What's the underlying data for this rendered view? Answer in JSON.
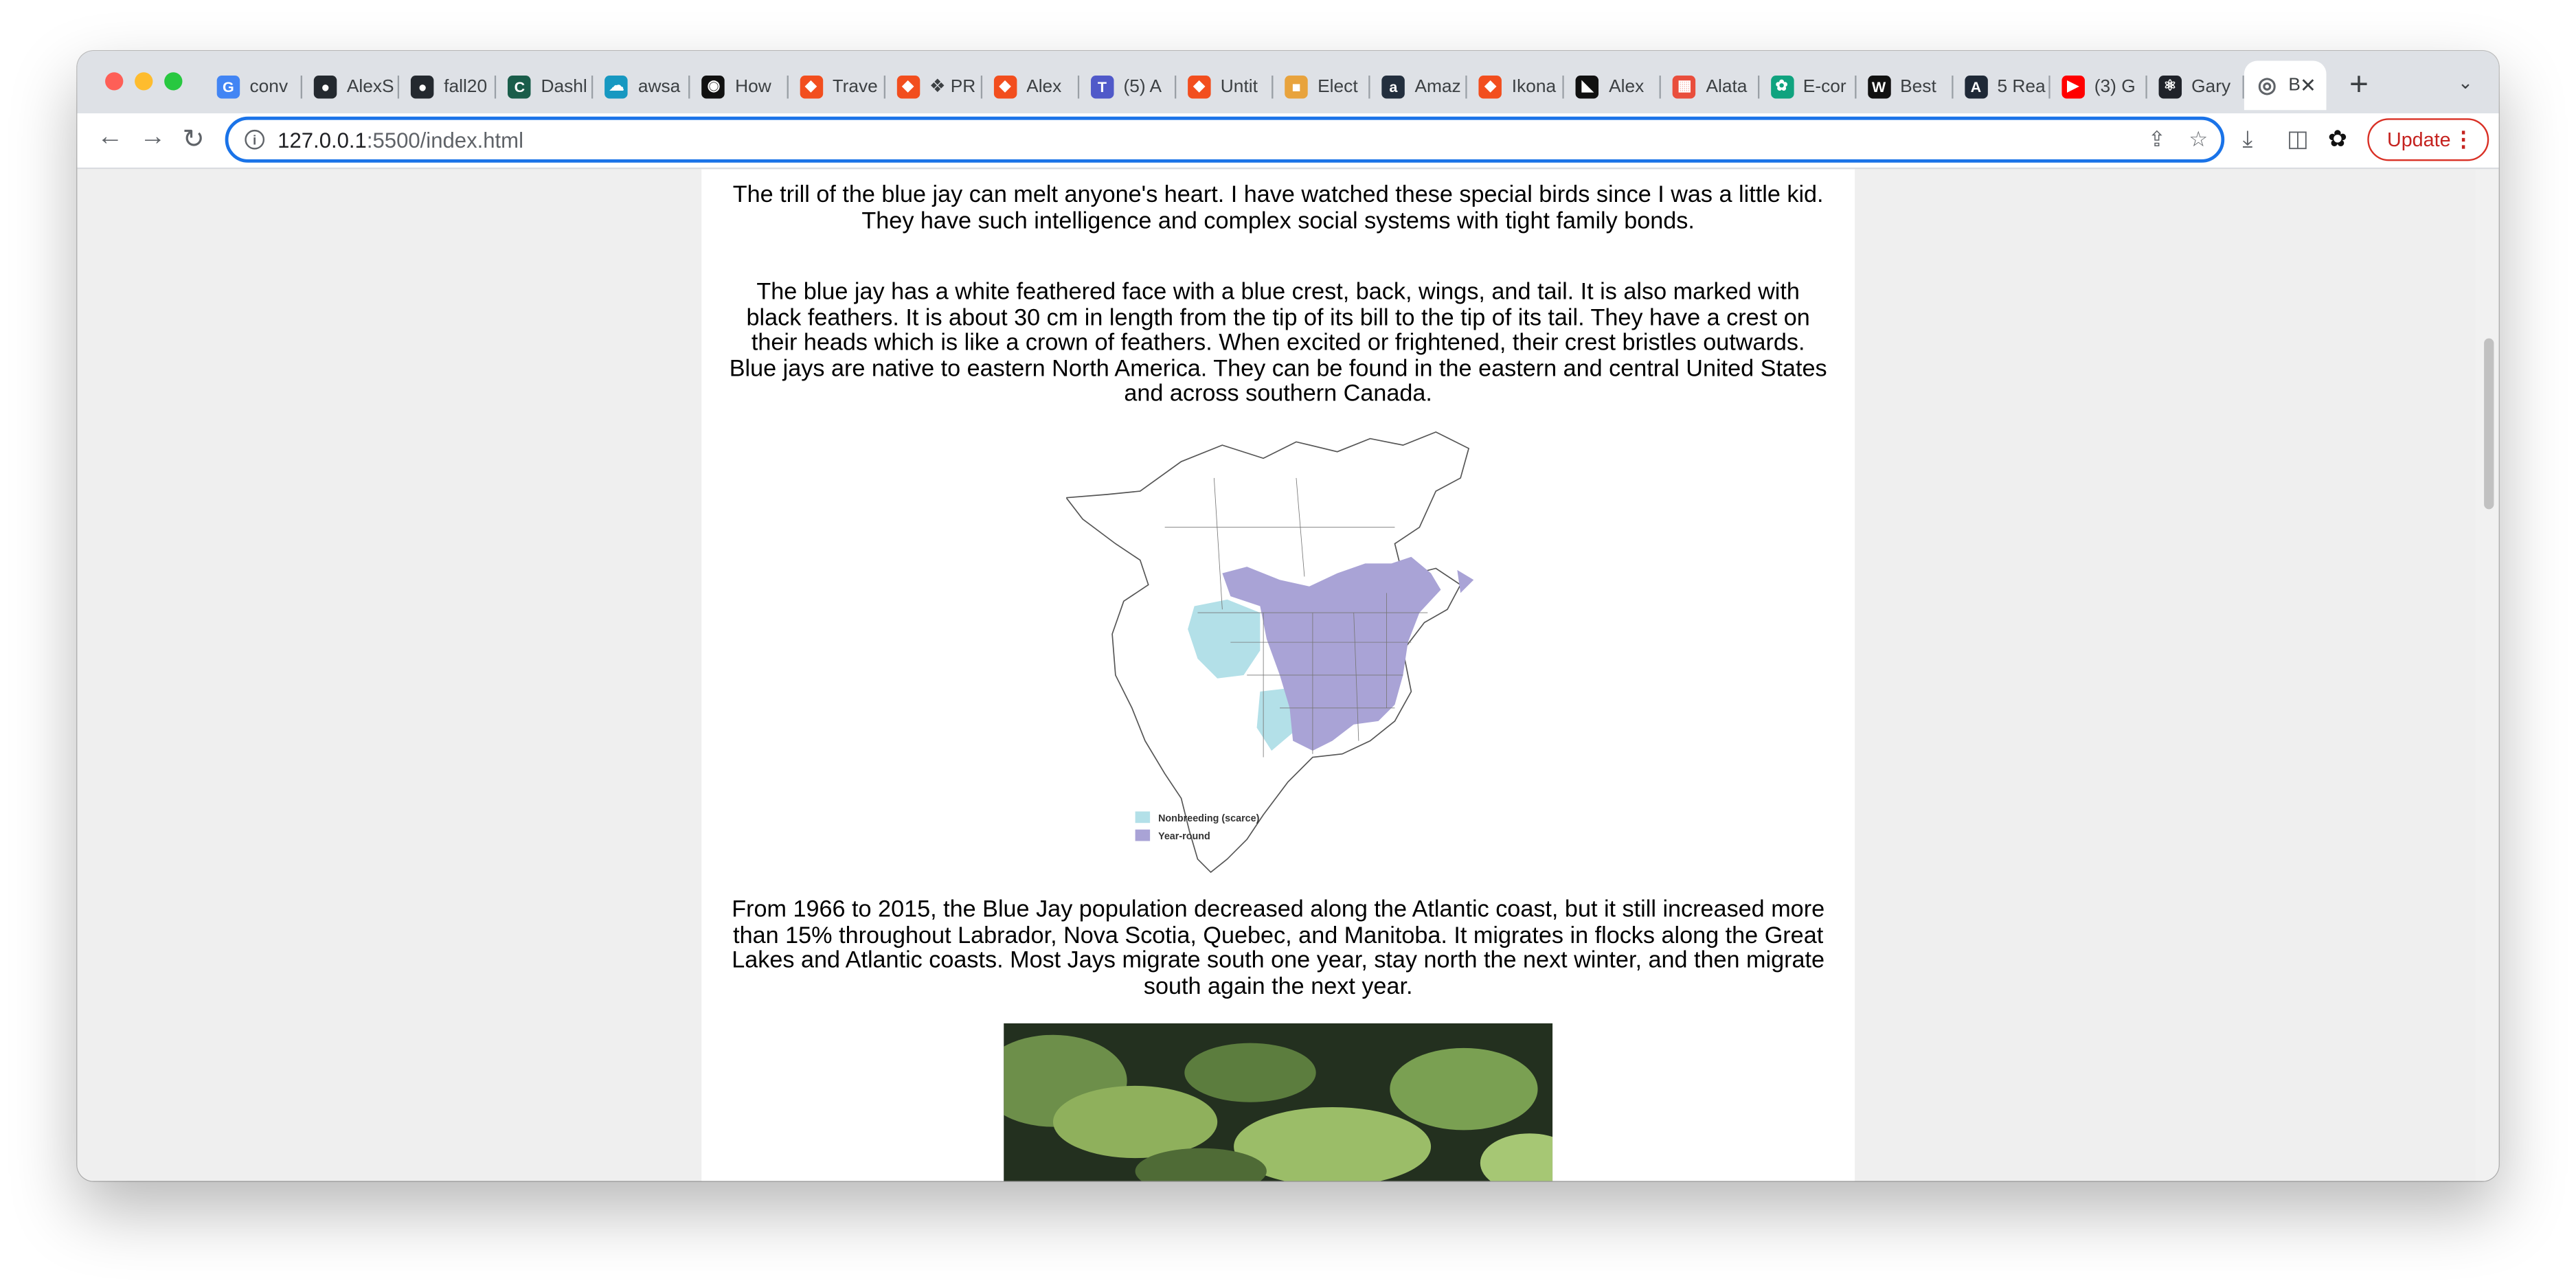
{
  "browser": {
    "tabs": [
      {
        "label": "conv",
        "icon": "google-icon",
        "color": "#4285f4"
      },
      {
        "label": "AlexS",
        "icon": "github-icon",
        "color": "#24292f"
      },
      {
        "label": "fall20",
        "icon": "github-icon",
        "color": "#24292f"
      },
      {
        "label": "Dashl",
        "icon": "codecademy-icon",
        "color": "#1a5d4a"
      },
      {
        "label": "awsa",
        "icon": "salesforce-cloud-icon",
        "color": "#1798c1"
      },
      {
        "label": "How",
        "icon": "circle-logo-icon",
        "color": "#111111"
      },
      {
        "label": "Trave",
        "icon": "figma-icon",
        "color": "#f24e1e"
      },
      {
        "label": "❖ PR",
        "icon": "figma-icon",
        "color": "#f24e1e"
      },
      {
        "label": "Alex",
        "icon": "figma-icon",
        "color": "#f24e1e"
      },
      {
        "label": "(5) A",
        "icon": "teams-icon",
        "color": "#5059c9"
      },
      {
        "label": "Untit",
        "icon": "figma-icon",
        "color": "#f24e1e"
      },
      {
        "label": "Elect",
        "icon": "shopping-bag-icon",
        "color": "#e8a33d"
      },
      {
        "label": "Amaz",
        "icon": "amazon-icon",
        "color": "#232f3e"
      },
      {
        "label": "Ikona",
        "icon": "figma-icon",
        "color": "#f24e1e"
      },
      {
        "label": "Alex",
        "icon": "framer-icon",
        "color": "#111111"
      },
      {
        "label": "Alata",
        "icon": "grid-logo-icon",
        "color": "#e94e3c"
      },
      {
        "label": "E-cor",
        "icon": "chatgpt-icon",
        "color": "#10a37f"
      },
      {
        "label": "Best",
        "icon": "webflow-w-icon",
        "color": "#111111"
      },
      {
        "label": "5 Rea",
        "icon": "a-logo-icon",
        "color": "#1f2937"
      },
      {
        "label": "(3) G",
        "icon": "youtube-icon",
        "color": "#ff0000"
      },
      {
        "label": "Gary",
        "icon": "react-icon",
        "color": "#20232a"
      }
    ],
    "active_tab": {
      "label": "B",
      "icon": "globe-icon"
    },
    "new_tab": "+",
    "url_host": "127.0.0.1",
    "url_path": ":5500/index.html",
    "update_label": "Update"
  },
  "page": {
    "para1": "The trill of the blue jay can melt anyone's heart. I have watched these special birds since I was a little kid. They have such intelligence and complex social systems with tight family bonds.",
    "para2": "The blue jay has a white feathered face with a blue crest, back, wings, and tail. It is also marked with black feathers. It is about 30 cm in length from the tip of its bill to the tip of its tail. They have a crest on their heads which is like a crown of feathers. When excited or frightened, their crest bristles outwards. Blue jays are native to eastern North America. They can be found in the eastern and central United States and across southern Canada.",
    "map": {
      "legend": [
        {
          "label": "Nonbreeding (scarce)",
          "color": "#b3e0e8"
        },
        {
          "label": "Year-round",
          "color": "#a9a3d6"
        }
      ]
    },
    "para3": "From 1966 to 2015, the Blue Jay population decreased along the Atlantic coast, but it still increased more than 15% throughout Labrador, Nova Scotia, Quebec, and Manitoba. It migrates in flocks along the Great Lakes and Atlantic coasts. Most Jays migrate south one year, stay north the next winter, and then migrate south again the next year."
  }
}
